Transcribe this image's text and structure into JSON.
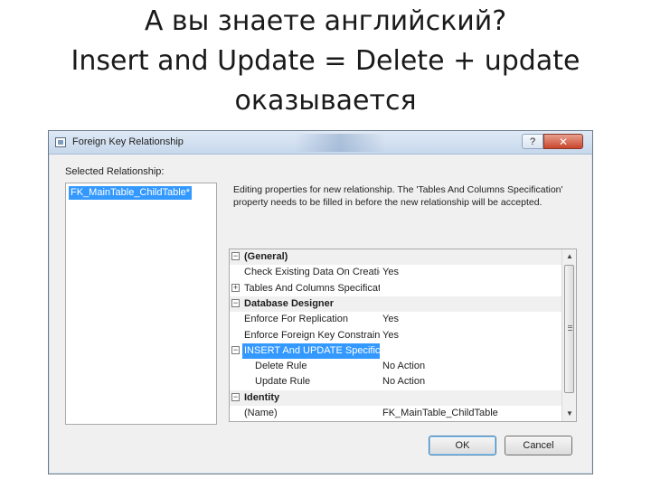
{
  "slide": {
    "title_lines": [
      "А вы знаете английский?",
      "Insert and Update = Delete + update",
      "оказывается"
    ]
  },
  "dialog": {
    "title": "Foreign Key Relationship",
    "help_label": "?",
    "close_label": "✕",
    "selected_relationship_label": "Selected Relationship:",
    "relationships": [
      "FK_MainTable_ChildTable*"
    ],
    "description": "Editing properties for new relationship.  The 'Tables And Columns Specification' property needs to be filled in before the new relationship will be accepted.",
    "properties": [
      {
        "type": "category",
        "expander": "⊟",
        "name": "(General)",
        "value": ""
      },
      {
        "type": "item",
        "expander": "",
        "name": "Check Existing Data On Creatio",
        "value": "Yes"
      },
      {
        "type": "item",
        "expander": "⊞",
        "name": "Tables And Columns Specificat",
        "value": ""
      },
      {
        "type": "category",
        "expander": "⊟",
        "name": "Database Designer",
        "value": ""
      },
      {
        "type": "item",
        "expander": "",
        "name": "Enforce For Replication",
        "value": "Yes"
      },
      {
        "type": "item",
        "expander": "",
        "name": "Enforce Foreign Key Constraint",
        "value": "Yes"
      },
      {
        "type": "selected",
        "expander": "⊟",
        "name": "INSERT And UPDATE Specificat",
        "value": ""
      },
      {
        "type": "child",
        "expander": "",
        "name": "Delete Rule",
        "value": "No Action"
      },
      {
        "type": "child",
        "expander": "",
        "name": "Update Rule",
        "value": "No Action"
      },
      {
        "type": "category",
        "expander": "⊟",
        "name": "Identity",
        "value": ""
      },
      {
        "type": "item",
        "expander": "",
        "name": "(Name)",
        "value": "FK_MainTable_ChildTable"
      }
    ],
    "scroll_up": "▲",
    "scroll_down": "▼",
    "ok_label": "OK",
    "cancel_label": "Cancel"
  }
}
